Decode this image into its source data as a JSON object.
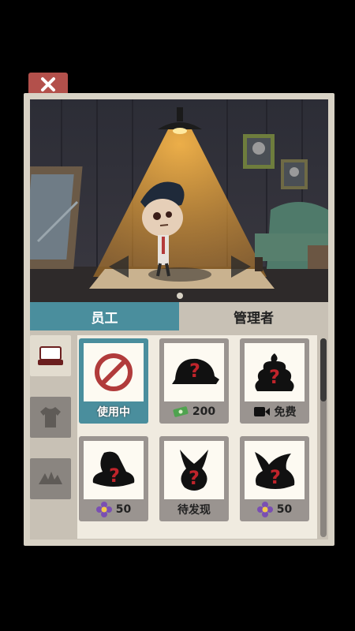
{
  "tabs": [
    {
      "label": "员工"
    },
    {
      "label": "管理者"
    }
  ],
  "items": [
    {
      "label": "使用中",
      "state": "equipped"
    },
    {
      "price": "200",
      "currency": "cash-icon"
    },
    {
      "price": "免费",
      "currency": "video-icon"
    },
    {
      "price": "50",
      "currency": "flower-gem-icon"
    },
    {
      "label": "待发现",
      "state": "undiscovered"
    },
    {
      "price": "50",
      "currency": "flower-gem-icon"
    }
  ],
  "colors": {
    "accent": "#4a8e9d",
    "close_tab": "#b3504b",
    "unknown_mark": "#c0242b"
  }
}
